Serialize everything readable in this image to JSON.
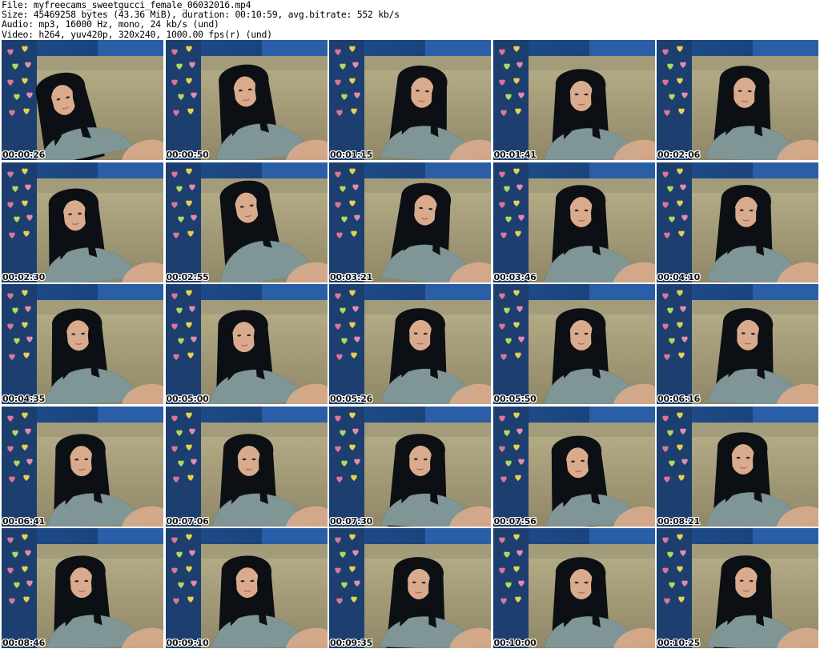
{
  "header": {
    "file": "File: myfreecams_sweetgucci_female_06032016.mp4",
    "size": "Size: 45469258 bytes (43.36 MiB), duration: 00:10:59, avg.bitrate: 552 kb/s",
    "audio": "Audio: mp3, 16000 Hz, mono, 24 kb/s (und)",
    "video": "Video: h264, yuv420p, 320x240, 1000.00 fps(r) (und)"
  },
  "thumbnails": [
    {
      "timestamp": "00:00:26"
    },
    {
      "timestamp": "00:00:50"
    },
    {
      "timestamp": "00:01:15"
    },
    {
      "timestamp": "00:01:41"
    },
    {
      "timestamp": "00:02:06"
    },
    {
      "timestamp": "00:02:30"
    },
    {
      "timestamp": "00:02:55"
    },
    {
      "timestamp": "00:03:21"
    },
    {
      "timestamp": "00:03:46"
    },
    {
      "timestamp": "00:04:10"
    },
    {
      "timestamp": "00:04:35"
    },
    {
      "timestamp": "00:05:00"
    },
    {
      "timestamp": "00:05:26"
    },
    {
      "timestamp": "00:05:50"
    },
    {
      "timestamp": "00:06:16"
    },
    {
      "timestamp": "00:06:41"
    },
    {
      "timestamp": "00:07:06"
    },
    {
      "timestamp": "00:07:30"
    },
    {
      "timestamp": "00:07:56"
    },
    {
      "timestamp": "00:08:21"
    },
    {
      "timestamp": "00:08:46"
    },
    {
      "timestamp": "00:09:10"
    },
    {
      "timestamp": "00:09:35"
    },
    {
      "timestamp": "00:10:00"
    },
    {
      "timestamp": "00:10:25"
    }
  ],
  "colors": {
    "wall": "#1f4e8c",
    "curtain": "#2a5ea6",
    "sofa": "#b8b08a",
    "sofa_shadow": "#8f8766",
    "hair": "#0c0f14",
    "skin": "#d9ab8c",
    "blouse": "#7f9596",
    "heart_colors": [
      "#e8789c",
      "#f2d94a",
      "#b7e35a",
      "#f08fb0"
    ]
  }
}
